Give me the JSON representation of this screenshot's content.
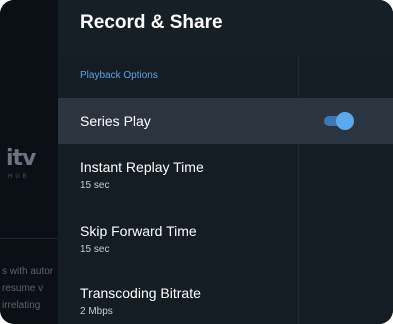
{
  "background": {
    "logo": "itv",
    "logo_sub": "HUB",
    "text_lines": [
      "s with autor",
      "resume v",
      "irrelating"
    ]
  },
  "header": {
    "title": "Record & Share"
  },
  "section": {
    "label": "Playback Options"
  },
  "rows": [
    {
      "label": "Series Play",
      "toggle_on": true
    },
    {
      "label": "Instant Replay Time",
      "value": "15 sec"
    },
    {
      "label": "Skip Forward Time",
      "value": "15 sec"
    },
    {
      "label": "Transcoding Bitrate",
      "value": "2 Mbps"
    }
  ],
  "colors": {
    "accent": "#5aa9f0",
    "section": "#5fa3e0",
    "selected_row": "#2c3440"
  }
}
